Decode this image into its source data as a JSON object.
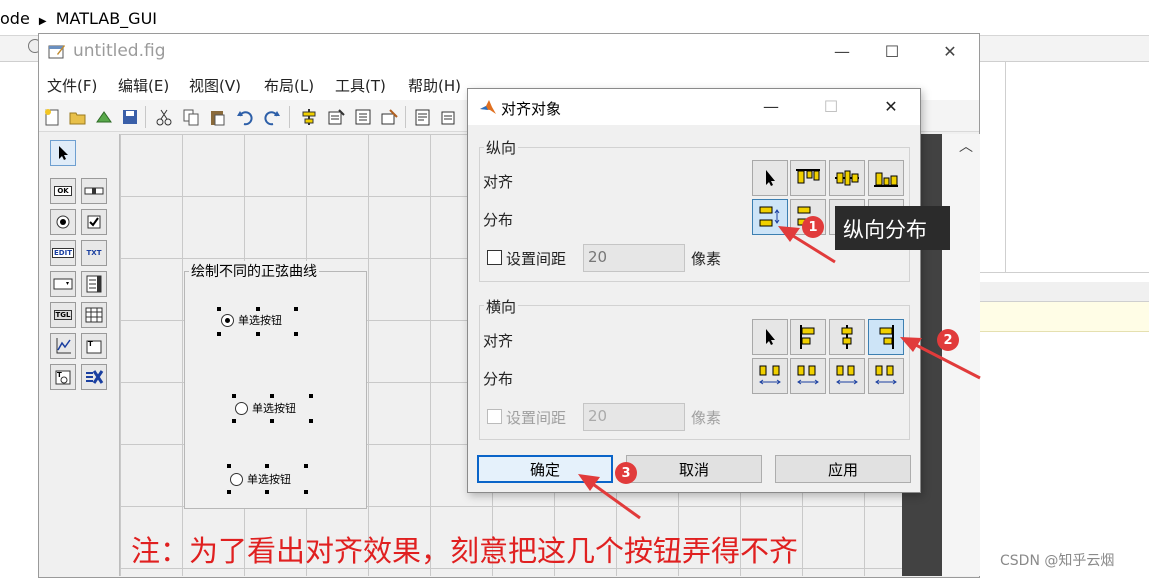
{
  "breadcrumb": {
    "partial": "ode",
    "folder": "MATLAB_GUI"
  },
  "guide": {
    "title": "untitled.fig",
    "menus": [
      "文件(F)",
      "编辑(E)",
      "视图(V)",
      "布局(L)",
      "工具(T)",
      "帮助(H)"
    ],
    "palette": [
      "OK",
      "EDIT",
      "TXT",
      "TGL"
    ],
    "panel_title": "绘制不同的正弦曲线",
    "radio_label": "单选按钮"
  },
  "dialog": {
    "title": "对齐对象",
    "vertical": {
      "title": "纵向",
      "align_label": "对齐",
      "distribute_label": "分布",
      "spacing_label": "设置间距",
      "spacing_value": "20",
      "unit": "像素"
    },
    "horizontal": {
      "title": "横向",
      "align_label": "对齐",
      "distribute_label": "分布",
      "spacing_label": "设置间距",
      "spacing_value": "20",
      "unit": "像素"
    },
    "buttons": {
      "ok": "确定",
      "cancel": "取消",
      "apply": "应用"
    }
  },
  "annotations": {
    "tooltip": "纵向分布",
    "badge1": "1",
    "badge2": "2",
    "badge3": "3",
    "note": "注：为了看出对齐效果，刻意把这几个按钮弄得不齐"
  },
  "watermark": "CSDN @知乎云烟",
  "colors": {
    "annotation_red": "#e02020",
    "selection_blue": "#cde4f7",
    "tooltip_bg": "#2b2b2b"
  }
}
